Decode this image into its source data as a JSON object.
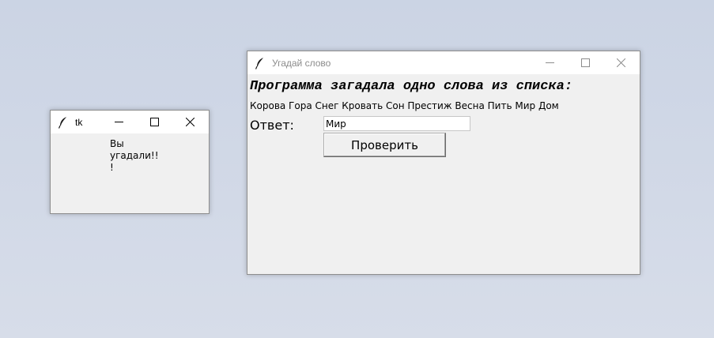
{
  "small_window": {
    "title": "tk",
    "message_lines": [
      "Вы",
      "угадали!!",
      "!"
    ]
  },
  "main_window": {
    "title": "Угадай слово",
    "heading": "Программа загадала одно слова из списка:",
    "words": "Корова Гора Снег Кровать Сон Престиж Весна Пить Мир Дом",
    "answer_label": "Ответ:",
    "answer_value": "Мир",
    "check_button_label": "Проверить"
  },
  "icons": {
    "app_icon": "feather-icon",
    "minimize": "minimize-icon",
    "maximize": "maximize-icon",
    "close": "close-icon"
  },
  "colors": {
    "desktop": "#cbd4e4",
    "window_bg": "#f0f0f0",
    "titlebar_bg": "#ffffff",
    "inactive_title": "#8c8c8c"
  }
}
